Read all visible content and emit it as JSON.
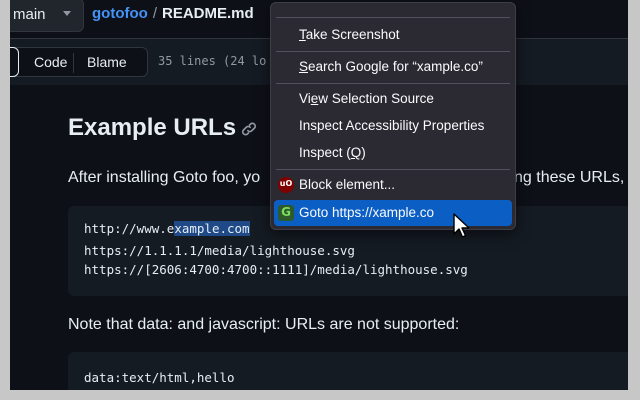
{
  "breadcrumb": {
    "branch": "main",
    "repo": "gotofoo",
    "separator": "/",
    "file": "README.md"
  },
  "toolbar": {
    "tabs": [
      "Code",
      "Blame"
    ],
    "lines_info": "35 lines (24 lo"
  },
  "markdown": {
    "heading": "Example URLs",
    "para1_left": "After installing Goto foo, yo",
    "para1_right": "ng these URLs, (",
    "code1": [
      {
        "before": "http://www.e",
        "highlight": "xample.com",
        "after": ""
      },
      {
        "before": "https://1.1.1.1/media/lighthouse.svg",
        "highlight": "",
        "after": ""
      },
      {
        "before": "https://[2606:4700:4700::1111]/media/lighthouse.svg",
        "highlight": "",
        "after": ""
      }
    ],
    "para2": "Note that data: and javascript: URLs are not supported:",
    "code2": [
      "data:text/html,hello"
    ]
  },
  "context_menu": {
    "items": [
      {
        "pre": "",
        "u": "T",
        "post": "ake Screenshot"
      },
      {
        "pre": "",
        "u": "S",
        "post": "earch Google for “xample.co”"
      },
      {
        "pre": "Vi",
        "u": "e",
        "post": "w Selection Source"
      },
      {
        "pre": "Inspect Accessibility Properties",
        "u": "",
        "post": ""
      },
      {
        "pre": "Inspect (",
        "u": "Q",
        "post": ")"
      },
      {
        "pre": "Block element...",
        "u": "",
        "post": ""
      },
      {
        "pre": "Goto https://xample.co",
        "u": "",
        "post": ""
      }
    ],
    "ublock_glyph": "uO",
    "goto_glyph": "G"
  },
  "colors": {
    "page_bg": "#0d1117",
    "link": "#4493f8",
    "menu_bg": "#2b2a33",
    "menu_highlight": "#0b5fc4",
    "selection": "#1f4a87"
  },
  "icons": [
    "chevron-down-icon",
    "link-icon",
    "ublock-icon",
    "goto-icon",
    "mouse-pointer-icon"
  ]
}
